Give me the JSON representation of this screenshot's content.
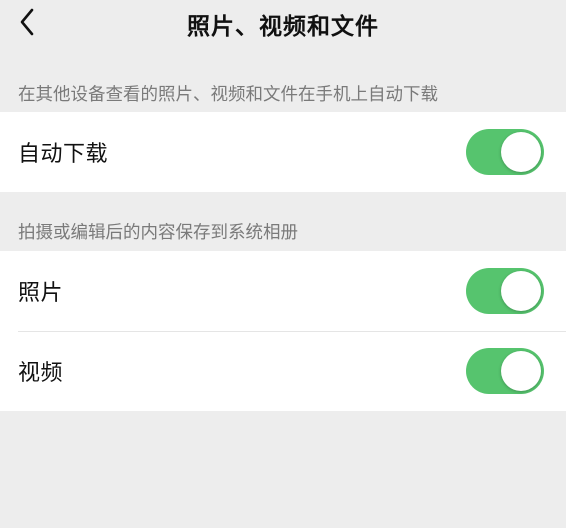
{
  "nav": {
    "title": "照片、视频和文件",
    "back_icon": "chevron-left-icon"
  },
  "sections": [
    {
      "header": "在其他设备查看的照片、视频和文件在手机上自动下载",
      "items": [
        {
          "label": "自动下载",
          "enabled": true
        }
      ]
    },
    {
      "header": "拍摄或编辑后的内容保存到系统相册",
      "items": [
        {
          "label": "照片",
          "enabled": true
        },
        {
          "label": "视频",
          "enabled": true
        }
      ]
    }
  ],
  "colors": {
    "background": "#ededed",
    "toggle_on": "#56c46e",
    "section_header_text": "#7a7a7a"
  }
}
